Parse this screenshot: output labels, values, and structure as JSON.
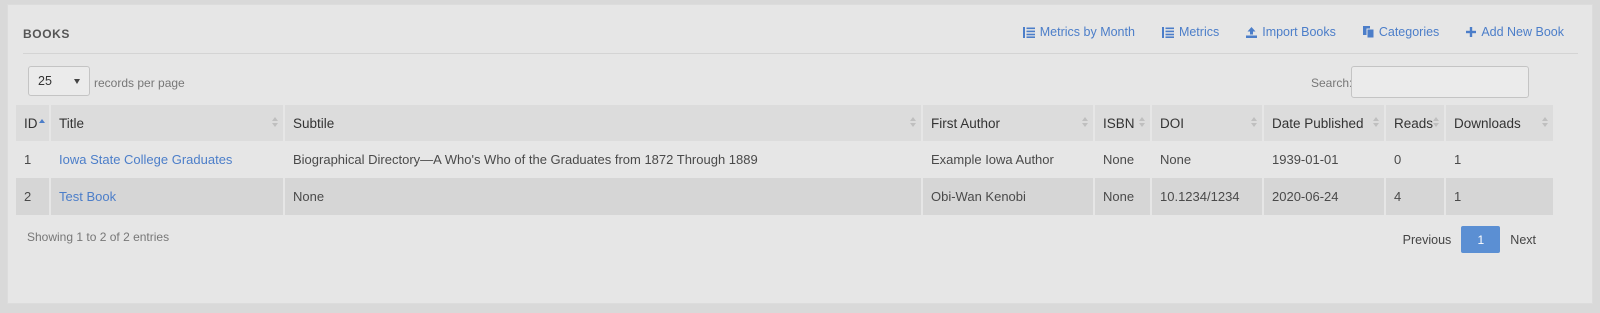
{
  "header": {
    "title": "BOOKS",
    "actions": [
      {
        "label": "Metrics by Month",
        "icon": "list-icon"
      },
      {
        "label": "Metrics",
        "icon": "list-icon"
      },
      {
        "label": "Import Books",
        "icon": "upload-icon"
      },
      {
        "label": "Categories",
        "icon": "copy-icon"
      },
      {
        "label": "Add New Book",
        "icon": "plus-icon"
      }
    ]
  },
  "length": {
    "value": "25",
    "label": "records per page"
  },
  "search": {
    "label": "Search:",
    "value": "",
    "placeholder": ""
  },
  "table": {
    "columns": [
      "ID",
      "Title",
      "Subtile",
      "First Author",
      "ISBN",
      "DOI",
      "Date Published",
      "Reads",
      "Downloads"
    ],
    "rows": [
      {
        "id": "1",
        "title": "Iowa State College Graduates",
        "subtitle": "Biographical Directory—A Who's Who of the Graduates from 1872 Through 1889",
        "author": "Example Iowa Author",
        "isbn": "None",
        "doi": "None",
        "date": "1939-01-01",
        "reads": "0",
        "downloads": "1"
      },
      {
        "id": "2",
        "title": "Test Book",
        "subtitle": "None",
        "author": "Obi-Wan Kenobi",
        "isbn": "None",
        "doi": "10.1234/1234",
        "date": "2020-06-24",
        "reads": "4",
        "downloads": "1"
      }
    ]
  },
  "footer": {
    "info": "Showing 1 to 2 of 2 entries",
    "previous": "Previous",
    "current_page": "1",
    "next": "Next"
  },
  "colors": {
    "accent": "#4c7ec9",
    "page_active": "#5b8fd3",
    "panel": "#e6e6e6"
  }
}
